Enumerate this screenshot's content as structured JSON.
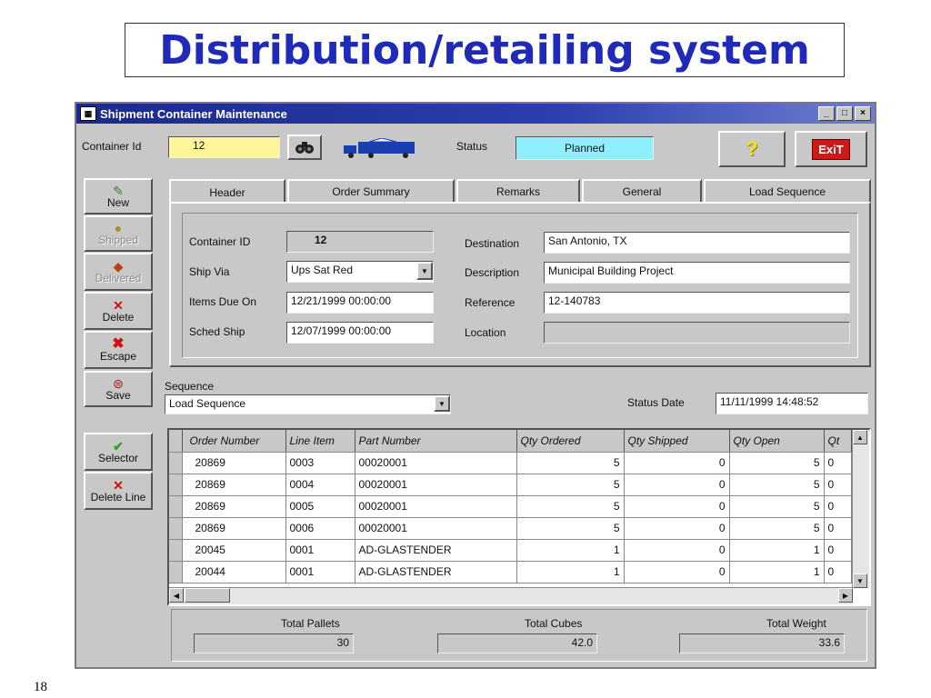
{
  "slide": {
    "title": "Distribution/retailing system",
    "page_number": "18"
  },
  "window": {
    "title": "Shipment Container Maintenance",
    "buttons": {
      "minimize": "_",
      "maximize": "□",
      "close": "×"
    }
  },
  "header": {
    "container_id_label": "Container Id",
    "container_id_value": "12",
    "status_label": "Status",
    "status_value": "Planned",
    "help_glyph": "?",
    "exit_label": "ExiT"
  },
  "sidebar": {
    "new": "New",
    "shipped": "Shipped",
    "delivered": "Delivered",
    "delete": "Delete",
    "escape": "Escape",
    "save": "Save",
    "selector": "Selector",
    "delete_line": "Delete Line"
  },
  "tabs": [
    "Header",
    "Order Summary",
    "Remarks",
    "General",
    "Load Sequence"
  ],
  "form": {
    "container_id_label": "Container ID",
    "container_id_value": "12",
    "ship_via_label": "Ship Via",
    "ship_via_value": "Ups Sat Red",
    "items_due_label": "Items Due On",
    "items_due_value": "12/21/1999 00:00:00",
    "sched_ship_label": "Sched Ship",
    "sched_ship_value": "12/07/1999 00:00:00",
    "destination_label": "Destination",
    "destination_value": "San Antonio, TX",
    "description_label": "Description",
    "description_value": "Municipal Building Project",
    "reference_label": "Reference",
    "reference_value": "12-140783",
    "location_label": "Location",
    "location_value": ""
  },
  "sequence": {
    "label": "Sequence",
    "value": "Load Sequence",
    "status_date_label": "Status Date",
    "status_date_value": "11/11/1999 14:48:52"
  },
  "grid": {
    "columns": [
      "Order Number",
      "Line Item",
      "Part Number",
      "Qty Ordered",
      "Qty Shipped",
      "Qty Open",
      "Qt"
    ],
    "rows": [
      [
        "20869",
        "0003",
        "00020001",
        "5",
        "0",
        "5",
        "0"
      ],
      [
        "20869",
        "0004",
        "00020001",
        "5",
        "0",
        "5",
        "0"
      ],
      [
        "20869",
        "0005",
        "00020001",
        "5",
        "0",
        "5",
        "0"
      ],
      [
        "20869",
        "0006",
        "00020001",
        "5",
        "0",
        "5",
        "0"
      ],
      [
        "20045",
        "0001",
        "AD-GLASTENDER",
        "1",
        "0",
        "1",
        "0"
      ],
      [
        "20044",
        "0001",
        "AD-GLASTENDER",
        "1",
        "0",
        "1",
        "0"
      ]
    ]
  },
  "totals": {
    "pallets_label": "Total Pallets",
    "pallets_value": "30",
    "cubes_label": "Total Cubes",
    "cubes_value": "42.0",
    "weight_label": "Total Weight",
    "weight_value": "33.6"
  }
}
